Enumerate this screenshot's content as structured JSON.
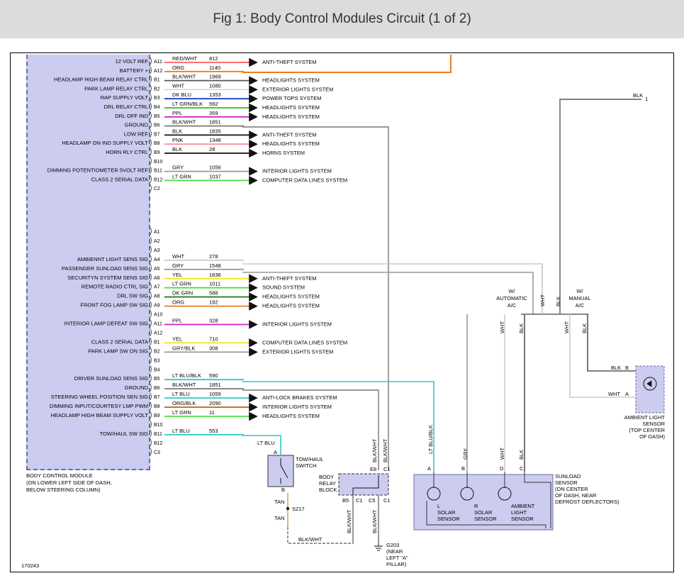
{
  "title": "Fig 1: Body Control Modules Circuit (1 of 2)",
  "figure_id": "170243",
  "upper_rows": [
    {
      "func": "12 VOLT REF",
      "pin": "A11",
      "color": "RED/WHT",
      "circuit": "812",
      "dest": "ANTI-THEFT SYSTEM",
      "wire": "#ff5a5a"
    },
    {
      "func": "BATTERY +",
      "pin": "A12",
      "color": "ORG",
      "circuit": "1140",
      "dest": "",
      "wire": "#f07a1a"
    },
    {
      "func": "HEADLAMP HIGH BEAM RELAY CTRL",
      "pin": "B1",
      "color": "BLK/WHT",
      "circuit": "1969",
      "dest": "HEADLIGHTS SYSTEM",
      "wire": "#555555"
    },
    {
      "func": "PARK LAMP RELAY CTRL",
      "pin": "B2",
      "color": "WHT",
      "circuit": "1080",
      "dest": "EXTERIOR LIGHTS SYSTEM",
      "wire": "#d8d8d8"
    },
    {
      "func": "RAP SUPPLY VOLT",
      "pin": "B3",
      "color": "DK BLU",
      "circuit": "1353",
      "dest": "POWER TOPS SYSTEM",
      "wire": "#1a3fbf"
    },
    {
      "func": "DRL RELAY CTRL",
      "pin": "B4",
      "color": "LT GRN/BLK",
      "circuit": "592",
      "dest": "HEADLIGHTS SYSTEM",
      "wire": "#22c32a"
    },
    {
      "func": "DRL OFF IND",
      "pin": "B5",
      "color": "PPL",
      "circuit": "359",
      "dest": "HEADLIGHTS SYSTEM",
      "wire": "#d020c8"
    },
    {
      "func": "GROUND",
      "pin": "B6",
      "color": "BLK/WHT",
      "circuit": "1851",
      "dest": "",
      "wire": "#777777"
    },
    {
      "func": "LOW REF",
      "pin": "B7",
      "color": "BLK",
      "circuit": "1835",
      "dest": "ANTI-THEFT SYSTEM",
      "wire": "#111111"
    },
    {
      "func": "HEADLAMP ON IND SUPPLY VOLT",
      "pin": "B8",
      "color": "PNK",
      "circuit": "1348",
      "dest": "HEADLIGHTS SYSTEM",
      "wire": "#ff8c9c"
    },
    {
      "func": "HORN RLY CTRL",
      "pin": "B9",
      "color": "BLK",
      "circuit": "28",
      "dest": "HORNS SYSTEM",
      "wire": "#111111"
    },
    {
      "func": "",
      "pin": "B10",
      "color": "",
      "circuit": "",
      "dest": "",
      "wire": ""
    },
    {
      "func": "DIMMING POTENTIOMETER 5VOLT REF",
      "pin": "B11",
      "color": "GRY",
      "circuit": "1056",
      "dest": "INTERIOR LIGHTS SYSTEM",
      "wire": "#9a9a9a"
    },
    {
      "func": "CLASS 2 SERIAL DATA",
      "pin": "B12",
      "color": "LT GRN",
      "circuit": "1037",
      "dest": "COMPUTER DATA LINES SYSTEM",
      "wire": "#44e040"
    },
    {
      "func": "",
      "pin": "C2",
      "color": "",
      "circuit": "",
      "dest": "",
      "wire": ""
    }
  ],
  "lower_rows": [
    {
      "func": "",
      "pin": "A1",
      "color": "",
      "circuit": "",
      "dest": "",
      "wire": ""
    },
    {
      "func": "",
      "pin": "A2",
      "color": "",
      "circuit": "",
      "dest": "",
      "wire": ""
    },
    {
      "func": "",
      "pin": "A3",
      "color": "",
      "circuit": "",
      "dest": "",
      "wire": ""
    },
    {
      "func": "AMBIENNT LIGHT SENS SIG",
      "pin": "A4",
      "color": "WHT",
      "circuit": "278",
      "dest": "",
      "wire": "#cccccc"
    },
    {
      "func": "PASSENGER SUNLOAD SENS SIG",
      "pin": "A5",
      "color": "GRY",
      "circuit": "1548",
      "dest": "",
      "wire": "#9a9a9a"
    },
    {
      "func": "SECURITYN SYSTEM SENS SIG",
      "pin": "A6",
      "color": "YEL",
      "circuit": "1836",
      "dest": "ANTI-THEFT SYSTEM",
      "wire": "#f2e01a"
    },
    {
      "func": "REMOTE RADIO CTRL SIG",
      "pin": "A7",
      "color": "LT GRN",
      "circuit": "1011",
      "dest": "SOUND SYSTEM",
      "wire": "#44e040"
    },
    {
      "func": "DRL SW SIG",
      "pin": "A8",
      "color": "DK GRN",
      "circuit": "588",
      "dest": "HEADLIGHTS SYSTEM",
      "wire": "#157a15"
    },
    {
      "func": "FRONT FOG LAMP SW SIG",
      "pin": "A9",
      "color": "ORG",
      "circuit": "192",
      "dest": "HEADLIGHTS SYSTEM",
      "wire": "#f07a1a"
    },
    {
      "func": "",
      "pin": "A10",
      "color": "",
      "circuit": "",
      "dest": "",
      "wire": ""
    },
    {
      "func": "INTERIOR LAMP DEFEAT SW SIG",
      "pin": "A11",
      "color": "PPL",
      "circuit": "328",
      "dest": "INTERIOR LIGHTS SYSTEM",
      "wire": "#d020c8"
    },
    {
      "func": "",
      "pin": "A12",
      "color": "",
      "circuit": "",
      "dest": "",
      "wire": ""
    },
    {
      "func": "CLASS 2 SERIAL DATA",
      "pin": "B1",
      "color": "YEL",
      "circuit": "710",
      "dest": "COMPUTER DATA LINES SYSTEM",
      "wire": "#f2e01a"
    },
    {
      "func": "PARK LAMP SW ON SIG",
      "pin": "B2",
      "color": "GRY/BLK",
      "circuit": "308",
      "dest": "EXTERIOR LIGHTS SYSTEM",
      "wire": "#9a9a9a"
    },
    {
      "func": "",
      "pin": "B3",
      "color": "",
      "circuit": "",
      "dest": "",
      "wire": ""
    },
    {
      "func": "",
      "pin": "B4",
      "color": "",
      "circuit": "",
      "dest": "",
      "wire": ""
    },
    {
      "func": "DRIVER SUNLOAD SENS SIG",
      "pin": "B5",
      "color": "LT BLU/BLK",
      "circuit": "590",
      "dest": "",
      "wire": "#2ec8c8"
    },
    {
      "func": "GROUND",
      "pin": "B6",
      "color": "BLK/WHT",
      "circuit": "1851",
      "dest": "",
      "wire": "#777777"
    },
    {
      "func": "STEERING WHEEL POSITION SEN SIG",
      "pin": "B7",
      "color": "LT BLU",
      "circuit": "1059",
      "dest": "ANTI-LOCK BRAKES SYSTEM",
      "wire": "#2ec8c8"
    },
    {
      "func": "DIMMING INPUT/COURTESY LMP PWM",
      "pin": "B8",
      "color": "ORG/BLK",
      "circuit": "2090",
      "dest": "INTERIOR LIGHTS SYSTEM",
      "wire": "#c86a1a"
    },
    {
      "func": "HEADLAMP HIGH BEAM SUPPLY VOLT",
      "pin": "B9",
      "color": "LT GRN",
      "circuit": "11",
      "dest": "HEADLIGHTS SYSTEM",
      "wire": "#44e040"
    },
    {
      "func": "",
      "pin": "B10",
      "color": "",
      "circuit": "",
      "dest": "",
      "wire": ""
    },
    {
      "func": "TOW/HAUL SW SIG",
      "pin": "B11",
      "color": "LT BLU",
      "circuit": "553",
      "dest": "",
      "wire": "#2ec8c8"
    },
    {
      "func": "",
      "pin": "B12",
      "color": "",
      "circuit": "",
      "dest": "",
      "wire": ""
    },
    {
      "func": "",
      "pin": "C3",
      "color": "",
      "circuit": "",
      "dest": "",
      "wire": ""
    }
  ],
  "bcm_label": [
    "BODY CONTROL MODULE",
    "(ON LOWER LEFT SIDE OF DASH,",
    "BELOW STEERING COLUMN)"
  ],
  "towhaul": {
    "wire_top": "LT BLU",
    "pin_a": "A",
    "pin_b": "B",
    "label": [
      "TOW/HAUL",
      "SWITCH"
    ],
    "tan1": "TAN",
    "splice": "S217",
    "tan2": "TAN",
    "blkwht": "BLK/WHT"
  },
  "relay_block": {
    "label": [
      "BODY",
      "RELAY",
      "BLOCK"
    ],
    "pin_e8": "E8",
    "pin_c1_top": "C1",
    "pin_b5": "B5",
    "pin_c1_l": "C1",
    "pin_c5": "C5",
    "pin_c1_r": "C1",
    "wire_top_1": "BLK/WHT",
    "wire_top_2": "BLK/WHT",
    "wire_bot_1": "BLK/WHT",
    "wire_bot_2": "BLK/WHT"
  },
  "ground": {
    "label": [
      "G203",
      "(NEAR",
      "LEFT \"A\"",
      "PILLAR)"
    ]
  },
  "sunload": {
    "label": [
      "SUNLOAD",
      "SENSOR",
      "(ON CENTER",
      "OF DASH, NEAR",
      "DEFROST DEFLECTORS)"
    ],
    "wires": [
      "LT BLU/BLK",
      "GRY",
      "WHT",
      "BLK"
    ],
    "pins": [
      "A",
      "B",
      "D",
      "C"
    ],
    "sensors": [
      [
        "L",
        "SOLAR",
        "SENSOR"
      ],
      [
        "R",
        "SOLAR",
        "SENSOR"
      ],
      [
        "AMBIENT",
        "LIGHT",
        "SENSOR"
      ]
    ]
  },
  "ac_options": {
    "auto": [
      "W/",
      "AUTOMATIC",
      "A/C"
    ],
    "manual": [
      "W/",
      "MANUAL",
      "A/C"
    ],
    "auto_wires": [
      "WHT",
      "BLK"
    ],
    "manual_wires": [
      "WHT",
      "BLK"
    ],
    "mid_wires": [
      "WHT",
      "BLK"
    ],
    "top_wire": "BLK",
    "top_pin": "1"
  },
  "ambient": {
    "pin_b_wire": "BLK",
    "pin_b": "B",
    "pin_a_wire": "WHT",
    "pin_a": "A",
    "label": [
      "AMBIENT LIGHT",
      "SENSOR",
      "(TOP CENTER",
      "OF DASH)"
    ]
  }
}
